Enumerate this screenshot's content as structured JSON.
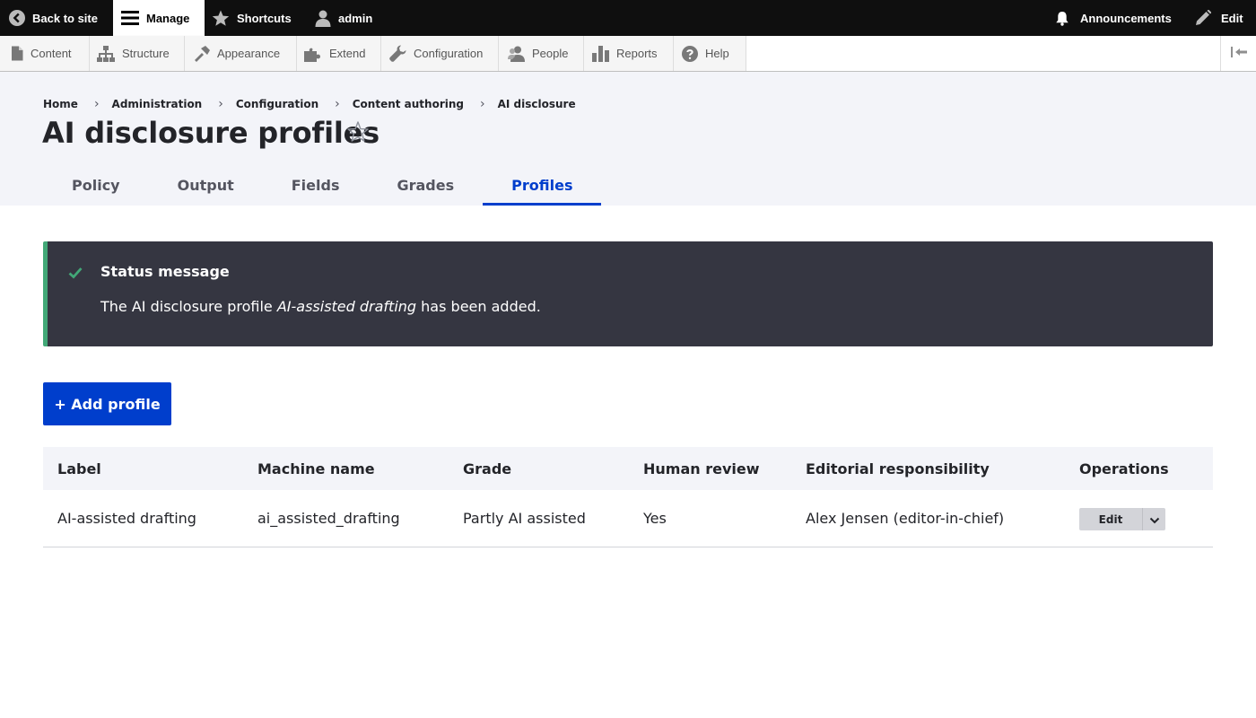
{
  "toolbar": {
    "back_to_site": "Back to site",
    "manage": "Manage",
    "shortcuts": "Shortcuts",
    "user": "admin",
    "announcements": "Announcements",
    "edit": "Edit"
  },
  "tray": {
    "items": [
      {
        "label": "Content",
        "icon": "file-icon"
      },
      {
        "label": "Structure",
        "icon": "sitemap-icon"
      },
      {
        "label": "Appearance",
        "icon": "brush-icon"
      },
      {
        "label": "Extend",
        "icon": "puzzle-icon"
      },
      {
        "label": "Configuration",
        "icon": "wrench-icon"
      },
      {
        "label": "People",
        "icon": "people-icon"
      },
      {
        "label": "Reports",
        "icon": "bar-chart-icon"
      },
      {
        "label": "Help",
        "icon": "help-icon"
      }
    ]
  },
  "breadcrumb": [
    "Home",
    "Administration",
    "Configuration",
    "Content authoring",
    "AI disclosure"
  ],
  "page": {
    "title": "AI disclosure profiles"
  },
  "tabs": [
    {
      "label": "Policy",
      "active": false
    },
    {
      "label": "Output",
      "active": false
    },
    {
      "label": "Fields",
      "active": false
    },
    {
      "label": "Grades",
      "active": false
    },
    {
      "label": "Profiles",
      "active": true
    }
  ],
  "status": {
    "title": "Status message",
    "text_before": "The AI disclosure profile ",
    "profile_name": "AI-assisted drafting",
    "text_after": " has been added."
  },
  "add_button": "+ Add profile",
  "table": {
    "headers": [
      "Label",
      "Machine name",
      "Grade",
      "Human review",
      "Editorial responsibility",
      "Operations"
    ],
    "rows": [
      {
        "label": "AI-assisted drafting",
        "machine_name": "ai_assisted_drafting",
        "grade": "Partly AI assisted",
        "human_review": "Yes",
        "responsibility": "Alex Jensen (editor-in-chief)",
        "operation": "Edit"
      }
    ]
  },
  "colors": {
    "accent": "#003ecc",
    "toolbar": "#0f0f0f",
    "status_bg": "#353641",
    "status_accent": "#42a877",
    "header_bg": "#f3f4f9"
  }
}
